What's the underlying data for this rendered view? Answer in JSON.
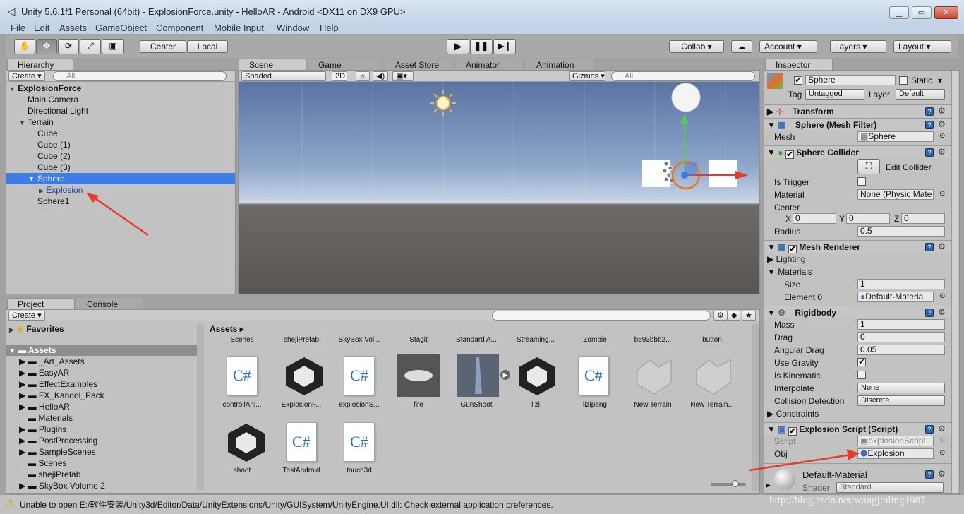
{
  "window": {
    "title": "Unity 5.6.1f1 Personal (64bit) - ExplosionForce.unity - HelloAR - Android <DX11 on DX9 GPU>",
    "min": "▁",
    "max": "▭",
    "close": "✕"
  },
  "menu": [
    "File",
    "Edit",
    "Assets",
    "GameObject",
    "Component",
    "Mobile Input",
    "Window",
    "Help"
  ],
  "toolbar": {
    "center": "Center",
    "local": "Local",
    "collab": "Collab ▾",
    "account": "Account",
    "layers": "Layers",
    "layout": "Layout"
  },
  "hierarchy": {
    "tab": "Hierarchy",
    "create": "Create ▾",
    "search_placeholder": "All",
    "scene": "ExplosionForce",
    "items": [
      {
        "label": "Main Camera"
      },
      {
        "label": "Directional Light"
      },
      {
        "label": "Terrain"
      },
      {
        "label": "Cube"
      },
      {
        "label": "Cube (1)"
      },
      {
        "label": "Cube (2)"
      },
      {
        "label": "Cube (3)"
      },
      {
        "label": "Sphere"
      },
      {
        "label": "Explosion"
      },
      {
        "label": "Sphere1"
      }
    ]
  },
  "scene_tabs": [
    "Scene",
    "Game",
    "Asset Store",
    "Animator",
    "Animation"
  ],
  "scene_bar": {
    "shading": "Shaded",
    "mode2d": "2D",
    "gizmos": "Gizmos ▾",
    "search_placeholder": "All"
  },
  "project": {
    "tabs": [
      "Project",
      "Console"
    ],
    "create": "Create ▾",
    "favorites": "Favorites",
    "assets_root": "Assets",
    "breadcrumb": "Assets",
    "folders": [
      "_Art_Assets",
      "EasyAR",
      "EffectExamples",
      "FX_Kandol_Pack",
      "HelloAR",
      "Materials",
      "Plugins",
      "PostProcessing",
      "SampleScenes",
      "Scenes",
      "shejiPrefab",
      "SkyBox Volume 2"
    ],
    "top_labels": [
      "Scenes",
      "shejiPrefab",
      "SkyBox Vol...",
      "Stagit",
      "Standard A...",
      "Streaming...",
      "Zombie",
      "b593bbb2...",
      "button"
    ],
    "row1": [
      {
        "label": "controllAni...",
        "kind": "cs"
      },
      {
        "label": "ExplosionF...",
        "kind": "unity"
      },
      {
        "label": "explosionS...",
        "kind": "cs"
      },
      {
        "label": "fire",
        "kind": "img"
      },
      {
        "label": "GunShoot",
        "kind": "gun"
      },
      {
        "label": "lizi",
        "kind": "unity"
      },
      {
        "label": "lizipeng",
        "kind": "cs"
      },
      {
        "label": "New Terrain",
        "kind": "terrain"
      },
      {
        "label": "New Terrain...",
        "kind": "terrain"
      }
    ],
    "row2": [
      {
        "label": "shoot",
        "kind": "unity"
      },
      {
        "label": "TestAndroid",
        "kind": "cs"
      },
      {
        "label": "touch3d",
        "kind": "cs"
      }
    ]
  },
  "inspector": {
    "tab": "Inspector",
    "name": "Sphere",
    "static": "Static",
    "tag_label": "Tag",
    "tag": "Untagged",
    "layer_label": "Layer",
    "layer": "Default",
    "transform": "Transform",
    "mesh_filter": {
      "title": "Sphere (Mesh Filter)",
      "mesh_label": "Mesh",
      "mesh": "Sphere"
    },
    "collider": {
      "title": "Sphere Collider",
      "edit": "Edit Collider",
      "trigger": "Is Trigger",
      "material_label": "Material",
      "material": "None (Physic Mate",
      "center": "Center",
      "x": "0",
      "y": "0",
      "z": "0",
      "radius_label": "Radius",
      "radius": "0.5"
    },
    "renderer": {
      "title": "Mesh Renderer",
      "lighting": "Lighting",
      "materials": "Materials",
      "size_label": "Size",
      "size": "1",
      "element_label": "Element 0",
      "element": "Default-Materia"
    },
    "rigidbody": {
      "title": "Rigidbody",
      "mass_label": "Mass",
      "mass": "1",
      "drag_label": "Drag",
      "drag": "0",
      "ang_label": "Angular Drag",
      "ang": "0.05",
      "gravity": "Use Gravity",
      "kinematic": "Is Kinematic",
      "interp_label": "Interpolate",
      "interp": "None",
      "coll_label": "Collision Detection",
      "coll": "Discrete",
      "constraints": "Constraints"
    },
    "script": {
      "title": "Explosion Script (Script)",
      "script_label": "Script",
      "script": "explosionScript",
      "obj_label": "Obj",
      "obj": "Explosion"
    },
    "material": {
      "name": "Default-Material",
      "shader_label": "Shader",
      "shader": "Standard"
    }
  },
  "status": "Unable to open E:/软件安装/Unity3d/Editor/Data/UnityExtensions/Unity/GUISystem/UnityEngine.UI.dll: Check external application preferences.",
  "watermark": "http://blog.csdn.net/wangjinling1987"
}
